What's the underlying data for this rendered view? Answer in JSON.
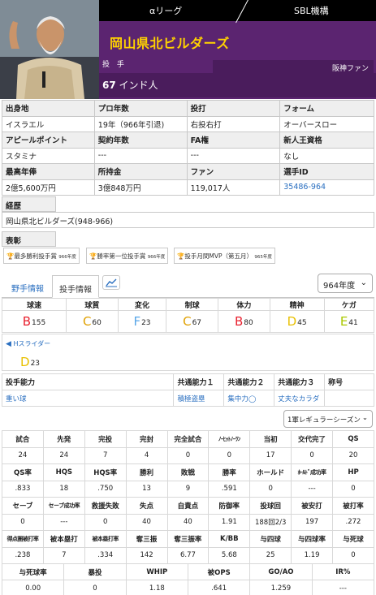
{
  "header": {
    "league_link": "αリーグ",
    "org_link": "SBL機構",
    "team_name": "岡山県北ビルダーズ",
    "position": "投 手",
    "fan": "阪神ファン",
    "number": "67",
    "name": "インド人"
  },
  "info": {
    "r1": {
      "h1": "出身地",
      "h2": "プロ年数",
      "h3": "投打",
      "h4": "フォーム"
    },
    "r2": {
      "v1": "イスラエル",
      "v2": "19年（966年引退)",
      "v3": "右投右打",
      "v4": "オーバースロー"
    },
    "r3": {
      "h1": "アピールポイント",
      "h2": "契約年数",
      "h3": "FA権",
      "h4": "新人王資格"
    },
    "r4": {
      "v1": "スタミナ",
      "v2": "---",
      "v3": "---",
      "v4": "なし"
    },
    "r5": {
      "h1": "最高年俸",
      "h2": "所持金",
      "h3": "ファン",
      "h4": "選手ID"
    },
    "r6": {
      "v1": "2億5,600万円",
      "v2": "3億848万円",
      "v3": "119,017人",
      "v4": "35486-964"
    }
  },
  "career": {
    "label": "経歴",
    "value": "岡山県北ビルダーズ(948-966)"
  },
  "awards": {
    "label": "表彰",
    "items": [
      {
        "text": "最多勝利投手賞",
        "year": "966年度"
      },
      {
        "text": "勝率第一位投手賞",
        "year": "966年度"
      },
      {
        "text": "投手月間MVP（第五月）",
        "year": "965年度"
      }
    ]
  },
  "tabs": {
    "fielder": "野手情報",
    "pitcher": "投手情報"
  },
  "year_select": "964年度",
  "abilities": {
    "headers": [
      "球速",
      "球質",
      "変化",
      "制球",
      "体力",
      "精神",
      "ケガ"
    ],
    "values": [
      {
        "grade": "B",
        "value": "155",
        "color": "#e8202e"
      },
      {
        "grade": "C",
        "value": "60",
        "color": "#e0a000"
      },
      {
        "grade": "F",
        "value": "23",
        "color": "#58a6e8"
      },
      {
        "grade": "C",
        "value": "67",
        "color": "#e0a000"
      },
      {
        "grade": "B",
        "value": "80",
        "color": "#e8202e"
      },
      {
        "grade": "D",
        "value": "45",
        "color": "#e8c000"
      },
      {
        "grade": "E",
        "value": "41",
        "color": "#aac800"
      }
    ]
  },
  "pitch": {
    "name": "Hスライダー",
    "grade": "D",
    "value": "23"
  },
  "skills": {
    "headers": [
      "投手能力",
      "共通能力１",
      "共通能力２",
      "共通能力３",
      "称号"
    ],
    "values": [
      "重い球",
      "積極盗塁",
      "集中力◯",
      "丈夫なカラダ",
      ""
    ]
  },
  "season_select": "1軍レギュラーシーズン",
  "stats": {
    "rows": [
      [
        "試合",
        "先発",
        "完投",
        "完封",
        "完全試合",
        "ﾉｰﾋｯﾄﾉｰﾗﾝ",
        "当初",
        "交代完了",
        "QS"
      ],
      [
        "24",
        "24",
        "7",
        "4",
        "0",
        "0",
        "17",
        "0",
        "20"
      ],
      [
        "QS率",
        "HQS",
        "HQS率",
        "勝利",
        "敗戦",
        "勝率",
        "ホールド",
        "ﾎｰﾙﾄﾞ成功率",
        "HP"
      ],
      [
        ".833",
        "18",
        ".750",
        "13",
        "9",
        ".591",
        "0",
        "---",
        "0"
      ],
      [
        "セーブ",
        "セーブ成功率",
        "救援失敗",
        "失点",
        "自責点",
        "防御率",
        "投球回",
        "被安打",
        "被打率"
      ],
      [
        "0",
        "---",
        "0",
        "40",
        "40",
        "1.91",
        "188回2/3",
        "197",
        ".272"
      ],
      [
        "得点圏被打率",
        "被本塁打",
        "被本塁打率",
        "奪三振",
        "奪三振率",
        "K/BB",
        "与四球",
        "与四球率",
        "与死球"
      ],
      [
        ".238",
        "7",
        ".334",
        "142",
        "6.77",
        "5.68",
        "25",
        "1.19",
        "0"
      ]
    ],
    "last_headers": [
      "与死球率",
      "暴投",
      "WHIP",
      "被OPS",
      "GO/AO",
      "IR%"
    ],
    "last_values": [
      "0.00",
      "0",
      "1.18",
      ".641",
      "1.259",
      "---"
    ]
  }
}
